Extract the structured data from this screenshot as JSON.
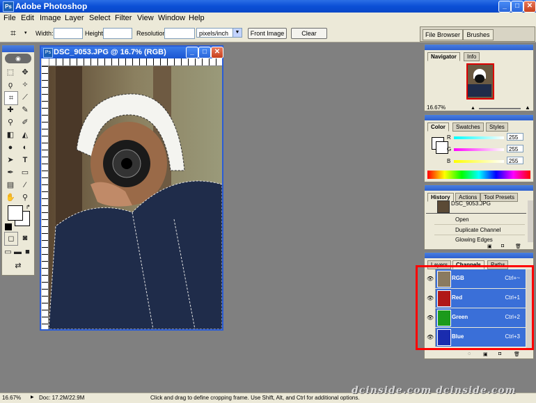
{
  "app": {
    "title": "Adobe Photoshop"
  },
  "menu": [
    "File",
    "Edit",
    "Image",
    "Layer",
    "Select",
    "Filter",
    "View",
    "Window",
    "Help"
  ],
  "options": {
    "width_label": "Width:",
    "height_label": "Height:",
    "resolution_label": "Resolution:",
    "units": "pixels/inch",
    "front_image": "Front Image",
    "clear": "Clear",
    "file_browser": "File Browser",
    "brushes": "Brushes"
  },
  "document": {
    "title": "DSC_9053.JPG @ 16.7% (RGB)"
  },
  "navigator": {
    "tabs": [
      "Navigator",
      "Info"
    ],
    "zoom": "16.67%"
  },
  "color": {
    "tabs": [
      "Color",
      "Swatches",
      "Styles"
    ],
    "r_label": "R",
    "g_label": "G",
    "b_label": "B",
    "r": "255",
    "g": "255",
    "b": "255"
  },
  "history": {
    "tabs": [
      "History",
      "Actions",
      "Tool Presets"
    ],
    "snapshot": "DSC_9053.JPG",
    "items": [
      "Open",
      "Duplicate Channel",
      "Glowing Edges"
    ]
  },
  "channels": {
    "tabs": [
      "Layers",
      "Channels",
      "Paths"
    ],
    "rows": [
      {
        "name": "RGB",
        "shortcut": "Ctrl+~",
        "color": "#8a7a60"
      },
      {
        "name": "Red",
        "shortcut": "Ctrl+1",
        "color": "#b01818"
      },
      {
        "name": "Green",
        "shortcut": "Ctrl+2",
        "color": "#1c9a1c"
      },
      {
        "name": "Blue",
        "shortcut": "Ctrl+3",
        "color": "#1a2cae"
      }
    ]
  },
  "status": {
    "zoom": "16.67%",
    "doc": "Doc: 17.2M/22.9M",
    "hint": "Click and drag to define cropping frame. Use Shift, Alt, and Ctrl for additional options."
  },
  "watermark": "dcinside.com dcinside.com"
}
